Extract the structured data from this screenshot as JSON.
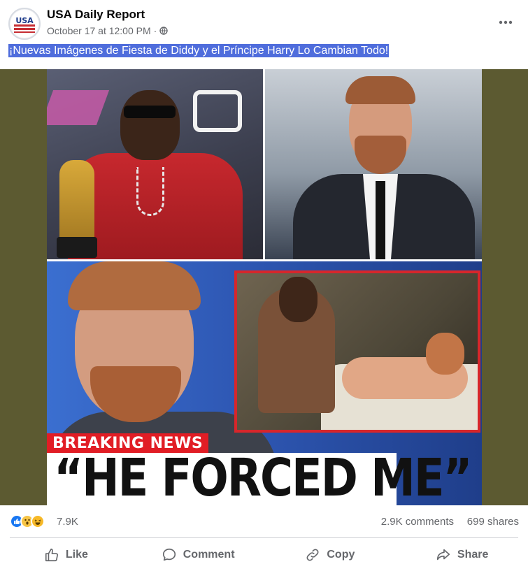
{
  "post": {
    "page_name": "USA Daily Report",
    "timestamp": "October 17 at 12:00 PM",
    "separator": "·",
    "privacy_icon": "globe-icon",
    "more_icon": "more-options-icon",
    "avatar_text": "USA",
    "caption": "¡Nuevas Imágenes de Fiesta de Diddy y el Príncipe Harry Lo Cambian Todo!",
    "image": {
      "banner_text": "BREAKING NEWS",
      "headline_text": "“HE FORCED ME”"
    }
  },
  "engagement": {
    "reaction_icons": [
      "like-reaction-icon",
      "wow-reaction-icon",
      "haha-reaction-icon"
    ],
    "reactions_count": "7.9K",
    "comments": "2.9K comments",
    "shares": "699 shares"
  },
  "actions": {
    "like": "Like",
    "comment": "Comment",
    "copy": "Copy",
    "share": "Share"
  },
  "colors": {
    "caption_highlight": "#4f6ddc",
    "media_backdrop": "#5c5a31",
    "breaking_red": "#e11d25",
    "like_blue": "#1877f2"
  }
}
